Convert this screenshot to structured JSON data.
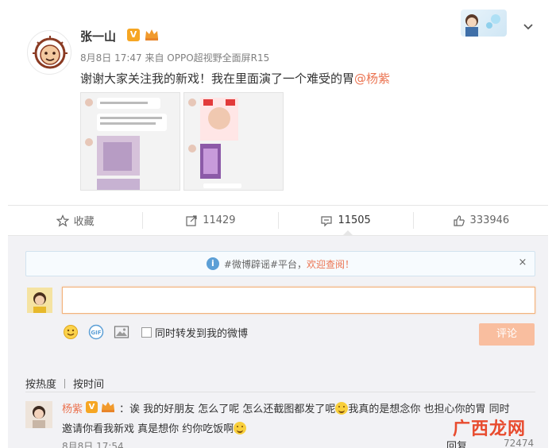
{
  "post": {
    "author": "张一山",
    "meta": "8月8日 17:47 来自 OPPO超视野全面屏R15",
    "text": "谢谢大家关注我的新戏！我在里面演了一个难受的胃",
    "mention": "@杨紫",
    "badge_v": "V"
  },
  "actions": {
    "favorite_label": "收藏",
    "repost_count": "11429",
    "comment_count": "11505",
    "like_count": "333946"
  },
  "notice": {
    "text": "#微博辟谣#平台，",
    "highlight": "欢迎查阅！",
    "close": "×"
  },
  "composer": {
    "sync_label": "同时转发到我的微博",
    "submit_label": "评论",
    "gif_label": "GIF"
  },
  "sort": {
    "hot": "按热度",
    "time": "按时间"
  },
  "comment": {
    "author": "杨紫",
    "badge_v": "V",
    "line1a": "：诶 我的好朋友 怎么了呢 怎么还截图都发了呢",
    "line1b": "我真的是想念你 也担心你的胃 同时",
    "line2": "邀请你看我新戏 真是想你 约你吃饭啊",
    "time": "8月8日 17:54",
    "reply": "回复",
    "likes": "72474"
  },
  "watermark": {
    "text": "广西龙网"
  },
  "colors": {
    "accent": "#eb7350",
    "submit": "#f9be9f",
    "panel_bg": "#f2f2f5"
  }
}
